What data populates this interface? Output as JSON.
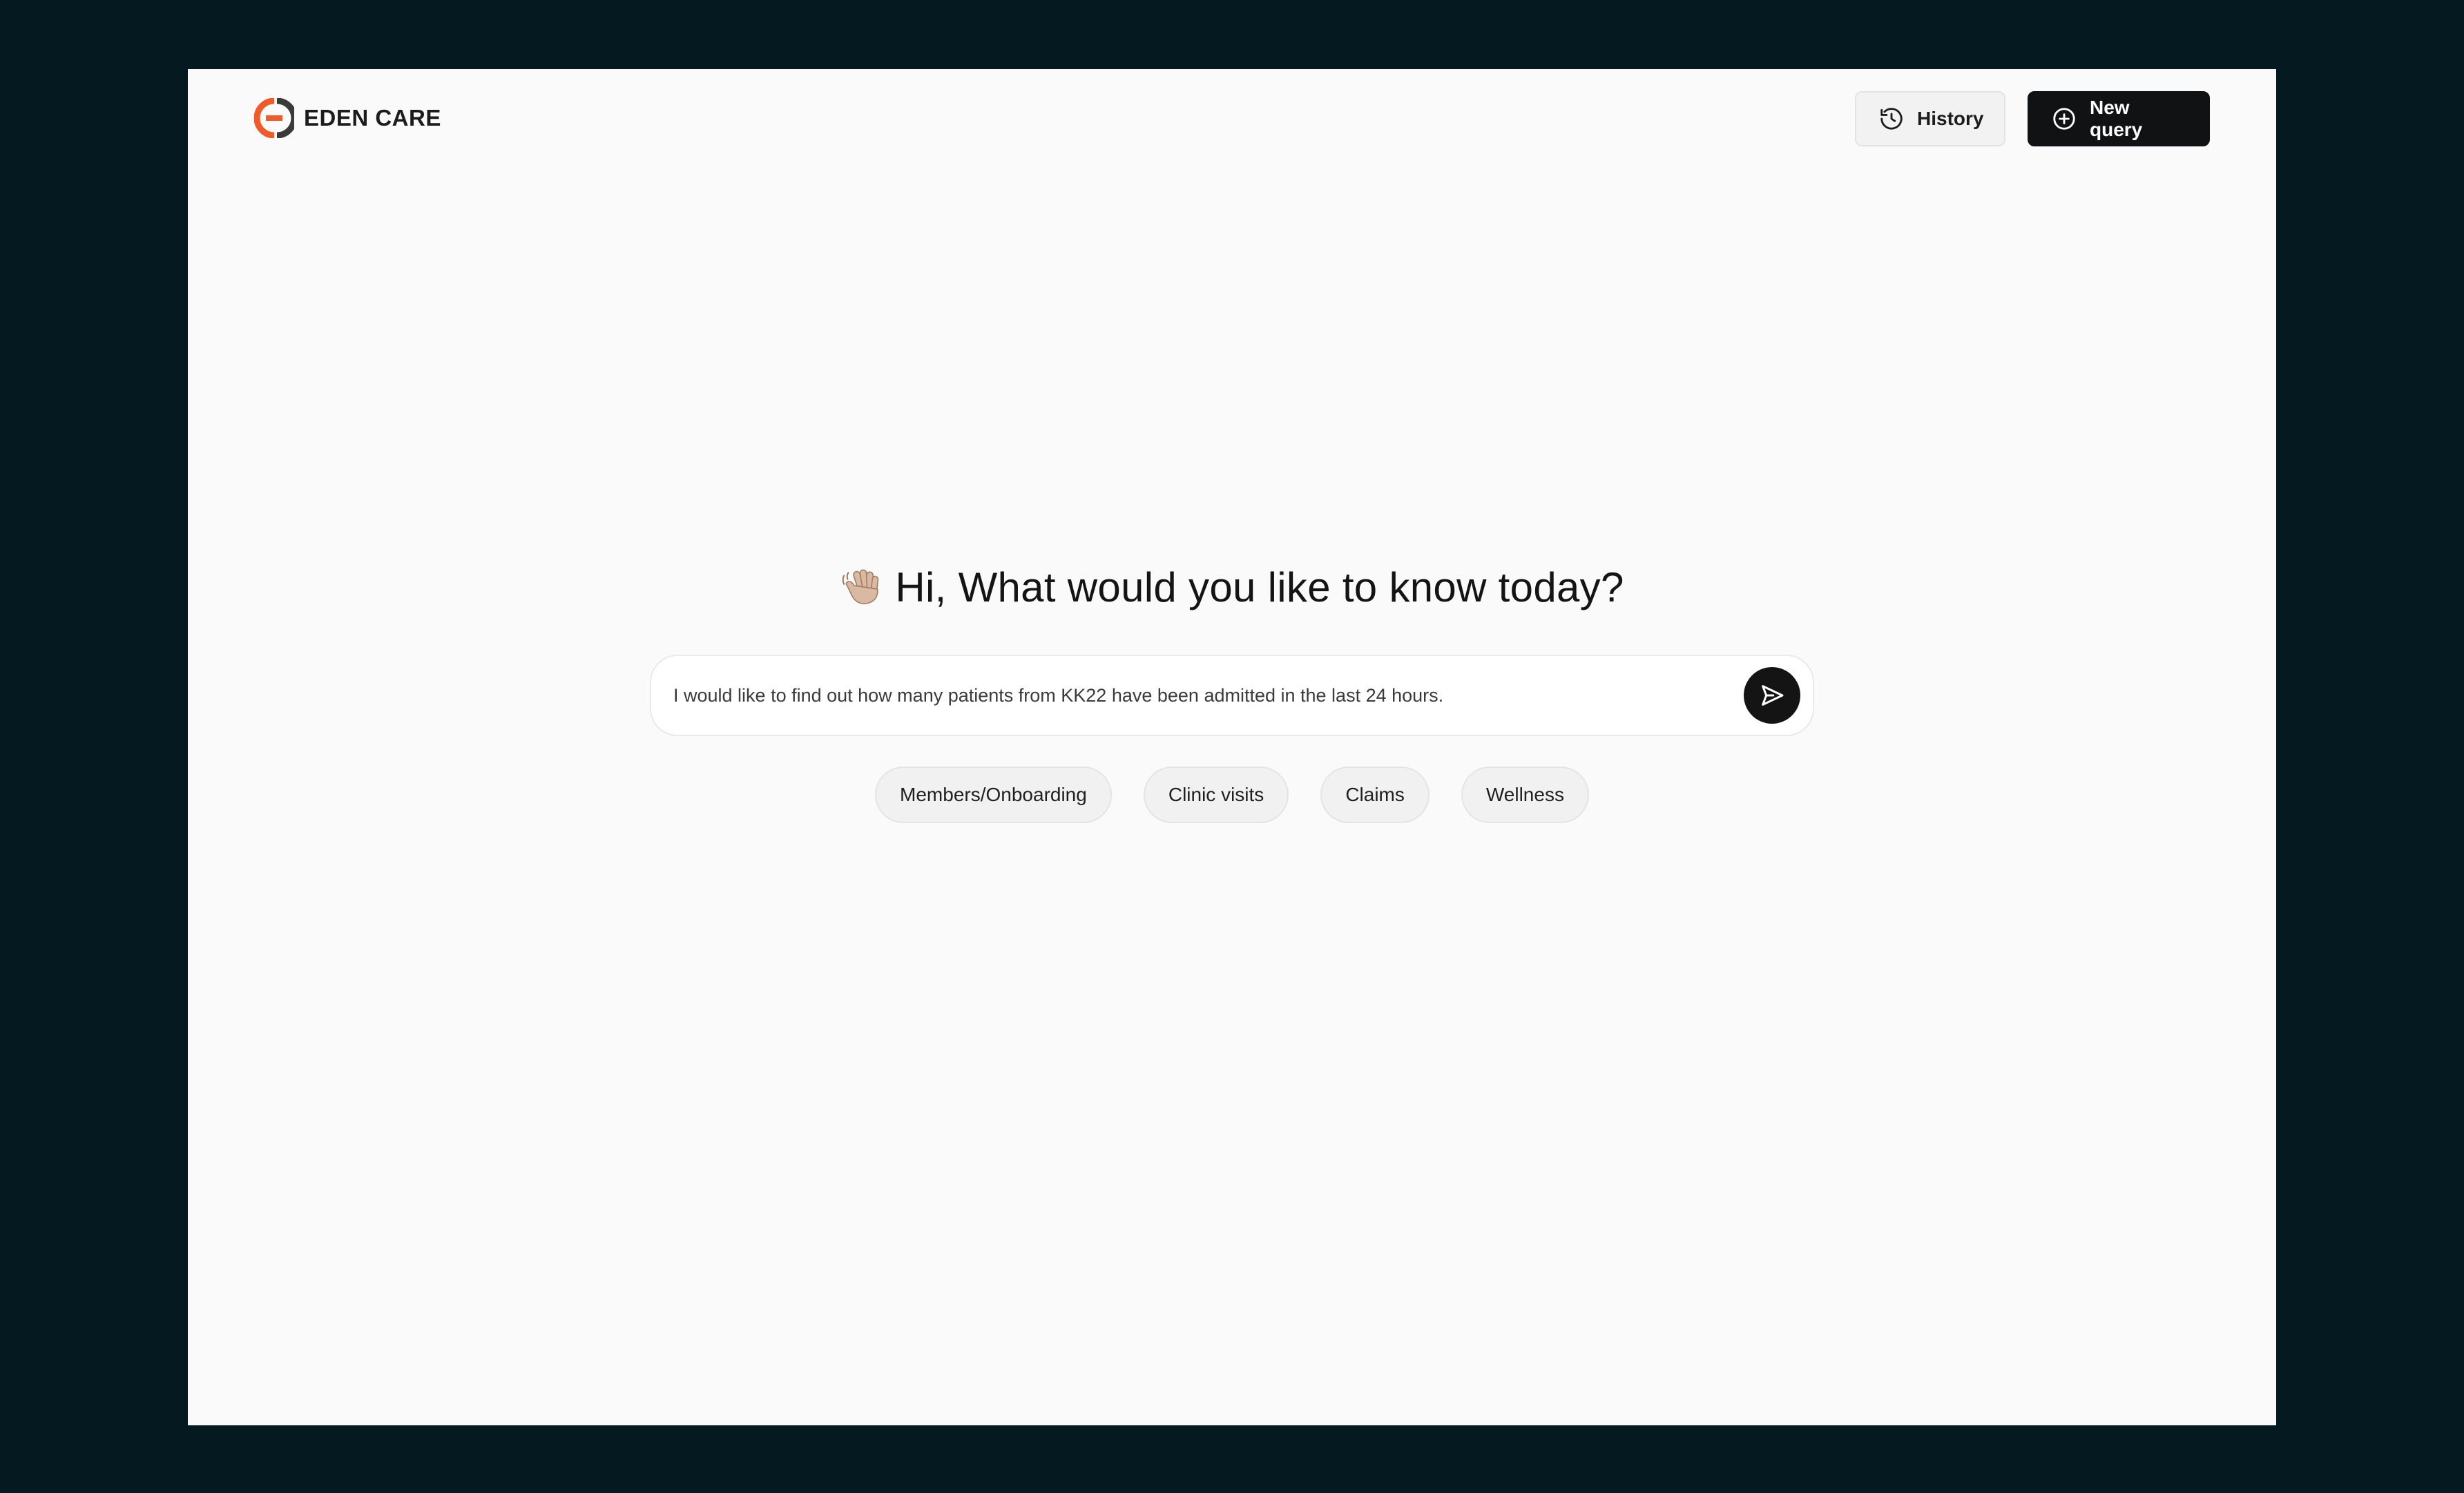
{
  "brand": {
    "name": "EDEN CARE",
    "logo_icon": "eden-care-logo-icon",
    "colors": {
      "accent": "#f15a29",
      "accent_dark": "#3a3a3a",
      "primary_button": "#111213",
      "background_outer": "#041920",
      "background_page": "#fafafa"
    }
  },
  "header": {
    "history_label": "History",
    "history_icon": "history-icon",
    "new_query_label": "New query",
    "new_query_icon": "plus-circle-icon"
  },
  "main": {
    "greeting_icon": "waving-hand-icon",
    "greeting": "Hi, What would you like to know today?",
    "query_value": "I would like to find out how many patients from KK22 have been admitted in the last 24 hours.",
    "send_icon": "send-icon",
    "suggestions": [
      "Members/Onboarding",
      "Clinic visits",
      "Claims",
      "Wellness"
    ]
  }
}
